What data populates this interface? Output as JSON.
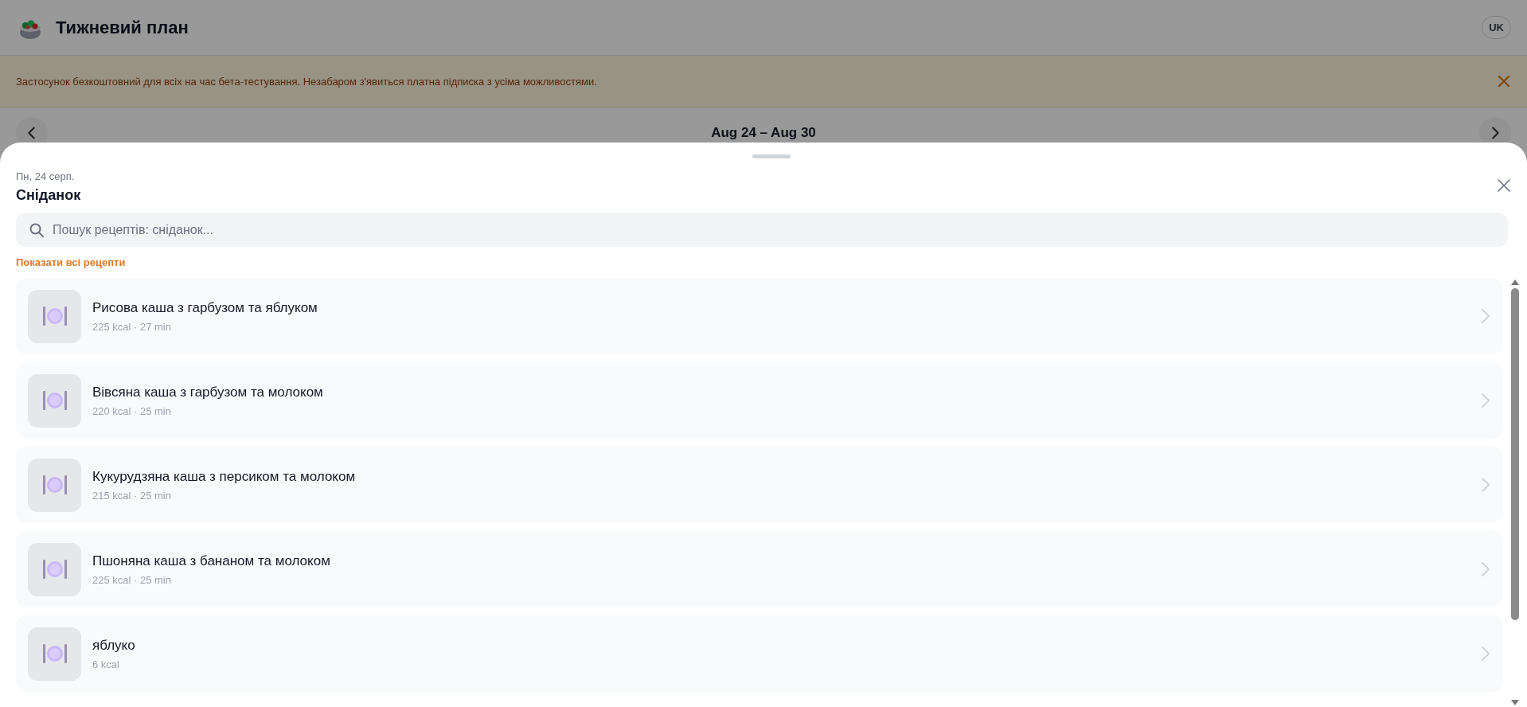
{
  "header": {
    "title": "Тижневий план",
    "language": "UK"
  },
  "banner": {
    "text": "Застосунок безкоштовний для всіх на час бета-тестування. Незабаром з'явиться платна підписка з усіма можливостями."
  },
  "week_nav": {
    "range": "Aug 24 – Aug 30"
  },
  "sheet": {
    "date": "Пн, 24 серп.",
    "meal": "Сніданок",
    "search": {
      "placeholder": "Пошук рецептів: сніданок..."
    },
    "show_all": "Показати всі рецепти",
    "recipes": [
      {
        "name": "Рисова каша з гарбузом та яблуком",
        "meta": "225 kcal · 27 min"
      },
      {
        "name": "Вівсяна каша з гарбузом та молоком",
        "meta": "220 kcal · 25 min"
      },
      {
        "name": "Кукурудзяна каша з персиком та молоком",
        "meta": "215 kcal · 25 min"
      },
      {
        "name": "Пшоняна каша з бананом та молоком",
        "meta": "225 kcal · 25 min"
      },
      {
        "name": "яблуко",
        "meta": "6 kcal"
      }
    ]
  }
}
